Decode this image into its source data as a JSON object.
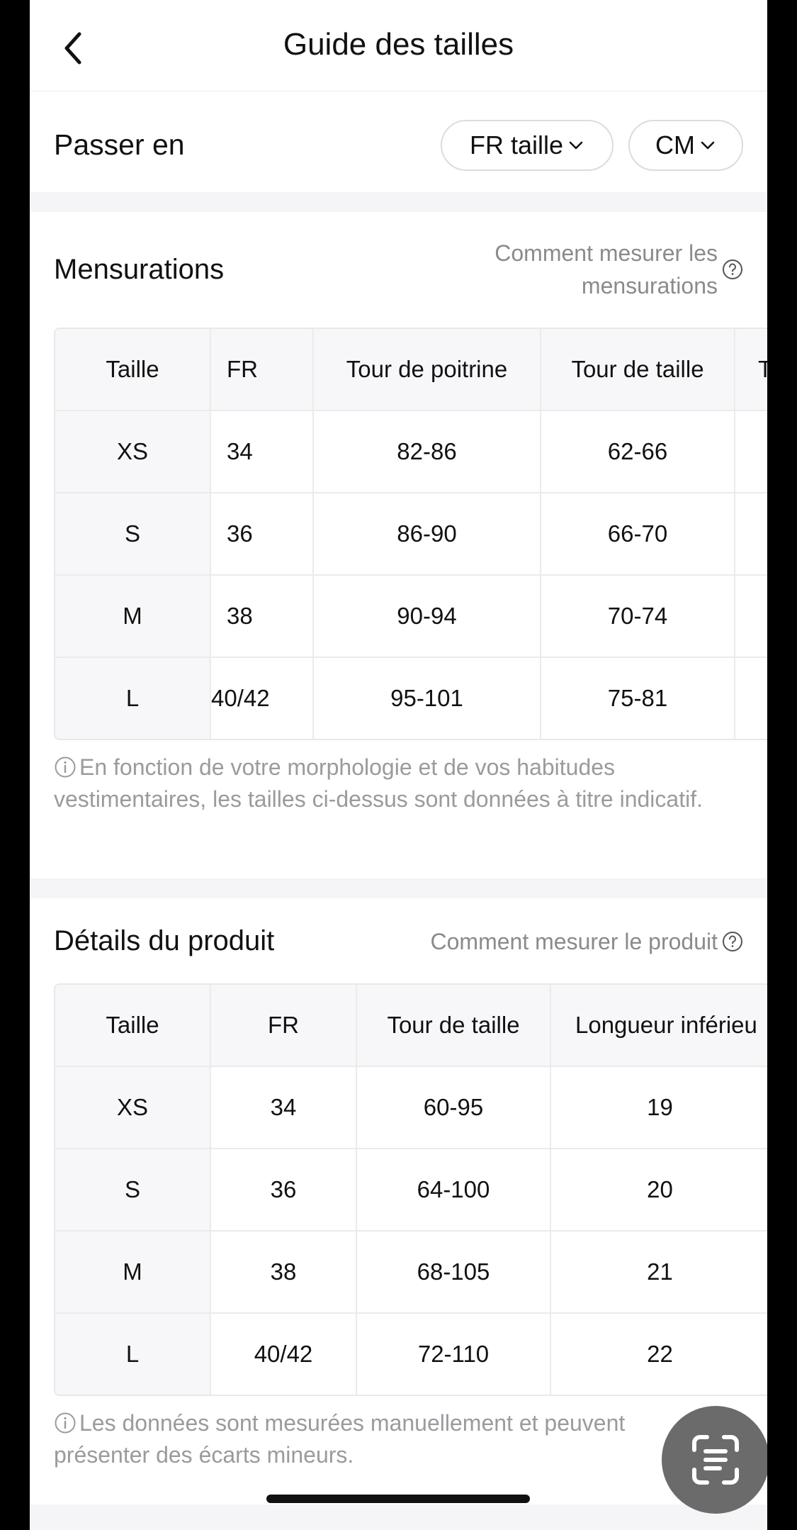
{
  "header": {
    "title": "Guide des tailles"
  },
  "switch": {
    "label": "Passer en",
    "size_system": "FR taille",
    "unit": "CM"
  },
  "body_measurements": {
    "title": "Mensurations",
    "how_line1": "Comment mesurer les",
    "how_line2": "mensurations",
    "columns": [
      "Taille",
      "FR",
      "Tour de poitrine",
      "Tour de taille",
      "T"
    ],
    "rows": [
      [
        "XS",
        "34",
        "82-86",
        "62-66"
      ],
      [
        "S",
        "36",
        "86-90",
        "66-70"
      ],
      [
        "M",
        "38",
        "90-94",
        "70-74"
      ],
      [
        "L",
        "40/42",
        "95-101",
        "75-81"
      ]
    ],
    "note": "En fonction de votre morphologie et de vos habitudes vestimentaires, les tailles ci-dessus sont données à titre indicatif."
  },
  "product_details": {
    "title": "Détails du produit",
    "how": "Comment mesurer le produit",
    "columns": [
      "Taille",
      "FR",
      "Tour de taille",
      "Longueur inférieu"
    ],
    "rows": [
      [
        "XS",
        "34",
        "60-95",
        "19"
      ],
      [
        "S",
        "36",
        "64-100",
        "20"
      ],
      [
        "M",
        "38",
        "68-105",
        "21"
      ],
      [
        "L",
        "40/42",
        "72-110",
        "22"
      ]
    ],
    "note": "Les données sont mesurées manuellement et peuvent présenter des écarts mineurs."
  }
}
